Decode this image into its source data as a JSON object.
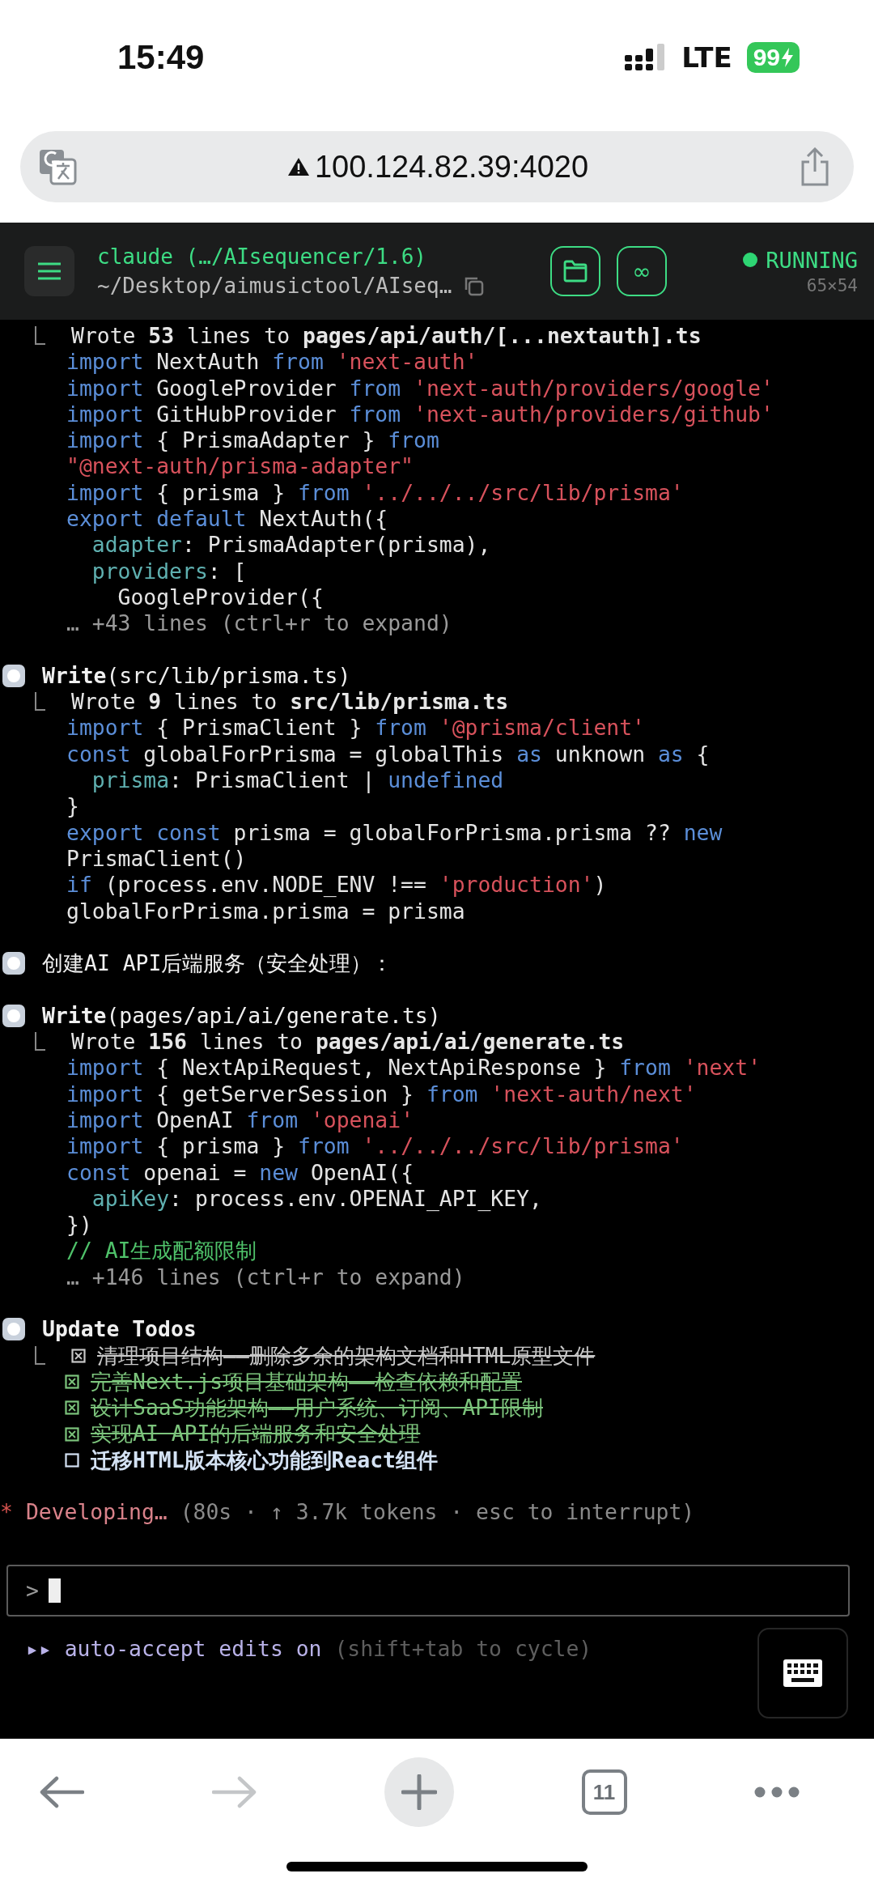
{
  "status_bar": {
    "time": "15:49",
    "network": "LTE",
    "battery": "99"
  },
  "address_bar": {
    "url": "100.124.82.39:4020"
  },
  "terminal_header": {
    "title": "claude (…/AIsequencer/1.6)",
    "path": "~/Desktop/aimusictool/AIseq…",
    "loop_button": "∞",
    "status": "RUNNING",
    "size": "65×54"
  },
  "output": [
    {
      "kind": "continuation",
      "result": "Wrote **53** lines to **pages/api/auth/[...nextauth].ts**",
      "code": [
        [
          {
            "kind": "kw",
            "text": "import "
          },
          {
            "kind": "tx",
            "text": "NextAuth "
          },
          {
            "kind": "kw",
            "text": "from "
          },
          {
            "kind": "str",
            "text": "'next-auth'"
          }
        ],
        [
          {
            "kind": "kw",
            "text": "import "
          },
          {
            "kind": "tx",
            "text": "GoogleProvider "
          },
          {
            "kind": "kw",
            "text": "from "
          },
          {
            "kind": "str",
            "text": "'next-auth/providers/google'"
          }
        ],
        [
          {
            "kind": "kw",
            "text": "import "
          },
          {
            "kind": "tx",
            "text": "GitHubProvider "
          },
          {
            "kind": "kw",
            "text": "from "
          },
          {
            "kind": "str",
            "text": "'next-auth/providers/github'"
          }
        ],
        [
          {
            "kind": "kw",
            "text": "import "
          },
          {
            "kind": "tx",
            "text": "{ PrismaAdapter } "
          },
          {
            "kind": "kw",
            "text": "from"
          }
        ],
        [
          {
            "kind": "str",
            "text": "\"@next-auth/prisma-adapter\""
          }
        ],
        [
          {
            "kind": "kw",
            "text": "import "
          },
          {
            "kind": "tx",
            "text": "{ prisma } "
          },
          {
            "kind": "kw",
            "text": "from "
          },
          {
            "kind": "str",
            "text": "'../../../src/lib/prisma'"
          }
        ],
        [
          {
            "kind": "kw",
            "text": "export default "
          },
          {
            "kind": "tx",
            "text": "NextAuth({"
          }
        ],
        [
          {
            "kind": "prop",
            "text": "  adapter"
          },
          {
            "kind": "tx",
            "text": ": PrismaAdapter(prisma),"
          }
        ],
        [
          {
            "kind": "prop",
            "text": "  providers"
          },
          {
            "kind": "tx",
            "text": ": ["
          }
        ],
        [
          {
            "kind": "tx",
            "text": "    GoogleProvider({"
          }
        ]
      ],
      "more": "… +43 lines (ctrl+r to expand)"
    },
    {
      "kind": "tool",
      "call": "**Write**(src/lib/prisma.ts)",
      "result": "Wrote **9** lines to **src/lib/prisma.ts**",
      "code": [
        [
          {
            "kind": "kw",
            "text": "import "
          },
          {
            "kind": "tx",
            "text": "{ PrismaClient } "
          },
          {
            "kind": "kw",
            "text": "from "
          },
          {
            "kind": "str",
            "text": "'@prisma/client'"
          }
        ],
        [
          {
            "kind": "kw",
            "text": "const "
          },
          {
            "kind": "tx",
            "text": "globalForPrisma = globalThis "
          },
          {
            "kind": "kw",
            "text": "as "
          },
          {
            "kind": "tx",
            "text": "unknown "
          },
          {
            "kind": "kw",
            "text": "as "
          },
          {
            "kind": "tx",
            "text": "{"
          }
        ],
        [
          {
            "kind": "prop",
            "text": "  prisma"
          },
          {
            "kind": "tx",
            "text": ": PrismaClient | "
          },
          {
            "kind": "kw",
            "text": "undefined"
          }
        ],
        [
          {
            "kind": "tx",
            "text": "}"
          }
        ],
        [
          {
            "kind": "kw",
            "text": "export const "
          },
          {
            "kind": "tx",
            "text": "prisma = globalForPrisma.prisma ?? "
          },
          {
            "kind": "kw",
            "text": "new"
          }
        ],
        [
          {
            "kind": "tx",
            "text": "PrismaClient()"
          }
        ],
        [
          {
            "kind": "kw",
            "text": "if "
          },
          {
            "kind": "tx",
            "text": "(process.env.NODE_ENV !== "
          },
          {
            "kind": "str",
            "text": "'production'"
          },
          {
            "kind": "tx",
            "text": ")"
          }
        ],
        [
          {
            "kind": "tx",
            "text": "globalForPrisma.prisma = prisma"
          }
        ]
      ]
    },
    {
      "kind": "message",
      "text": "创建AI API后端服务（安全处理）："
    },
    {
      "kind": "tool",
      "call": "**Write**(pages/api/ai/generate.ts)",
      "result": "Wrote **156** lines to **pages/api/ai/generate.ts**",
      "code": [
        [
          {
            "kind": "kw",
            "text": "import "
          },
          {
            "kind": "tx",
            "text": "{ NextApiRequest, NextApiResponse } "
          },
          {
            "kind": "kw",
            "text": "from "
          },
          {
            "kind": "str",
            "text": "'next'"
          }
        ],
        [
          {
            "kind": "kw",
            "text": "import "
          },
          {
            "kind": "tx",
            "text": "{ getServerSession } "
          },
          {
            "kind": "kw",
            "text": "from "
          },
          {
            "kind": "str",
            "text": "'next-auth/next'"
          }
        ],
        [
          {
            "kind": "kw",
            "text": "import "
          },
          {
            "kind": "tx",
            "text": "OpenAI "
          },
          {
            "kind": "kw",
            "text": "from "
          },
          {
            "kind": "str",
            "text": "'openai'"
          }
        ],
        [
          {
            "kind": "kw",
            "text": "import "
          },
          {
            "kind": "tx",
            "text": "{ prisma } "
          },
          {
            "kind": "kw",
            "text": "from "
          },
          {
            "kind": "str",
            "text": "'../../../src/lib/prisma'"
          }
        ],
        [
          {
            "kind": "kw",
            "text": "const "
          },
          {
            "kind": "tx",
            "text": "openai = "
          },
          {
            "kind": "kw",
            "text": "new "
          },
          {
            "kind": "tx",
            "text": "OpenAI({"
          }
        ],
        [
          {
            "kind": "prop",
            "text": "  apiKey"
          },
          {
            "kind": "tx",
            "text": ": process.env.OPENAI_API_KEY,"
          }
        ],
        [
          {
            "kind": "tx",
            "text": "})"
          }
        ],
        [
          {
            "kind": "cm",
            "text": "// AI生成配额限制"
          }
        ]
      ],
      "more": "… +146 lines (ctrl+r to expand)"
    },
    {
      "kind": "todos",
      "title": "Update Todos",
      "items": [
        {
          "text": "清理项目结构——删除多余的架构文档和HTML原型文件",
          "checked": true,
          "color": "#c8c8c8"
        },
        {
          "text": "完善Next.js项目基础架构——检查依赖和配置",
          "checked": true,
          "color": "#7cc47c"
        },
        {
          "text": "设计SaaS功能架构——用户系统、订阅、API限制",
          "checked": true,
          "color": "#7cc47c"
        },
        {
          "text": "实现AI API的后端服务和安全处理",
          "checked": true,
          "color": "#7cc47c"
        },
        {
          "text": "迁移HTML版本核心功能到React组件",
          "checked": false,
          "color": "#d4e2f4"
        }
      ]
    }
  ],
  "progress": {
    "spinner": "*",
    "status": "Developing…",
    "detail": "(80s · ↑ 3.7k tokens · esc to interrupt)"
  },
  "prompt": {
    "symbol": ">"
  },
  "mode": {
    "label": "▸▸ auto-accept edits on",
    "hint": "(shift+tab to cycle)"
  },
  "toolbar": [
    {
      "kind": "back",
      "disabled": false
    },
    {
      "kind": "forward",
      "disabled": true
    },
    {
      "kind": "new-tab",
      "disabled": false
    },
    {
      "kind": "tabs",
      "label": "11",
      "disabled": false
    },
    {
      "kind": "more",
      "disabled": false
    }
  ]
}
